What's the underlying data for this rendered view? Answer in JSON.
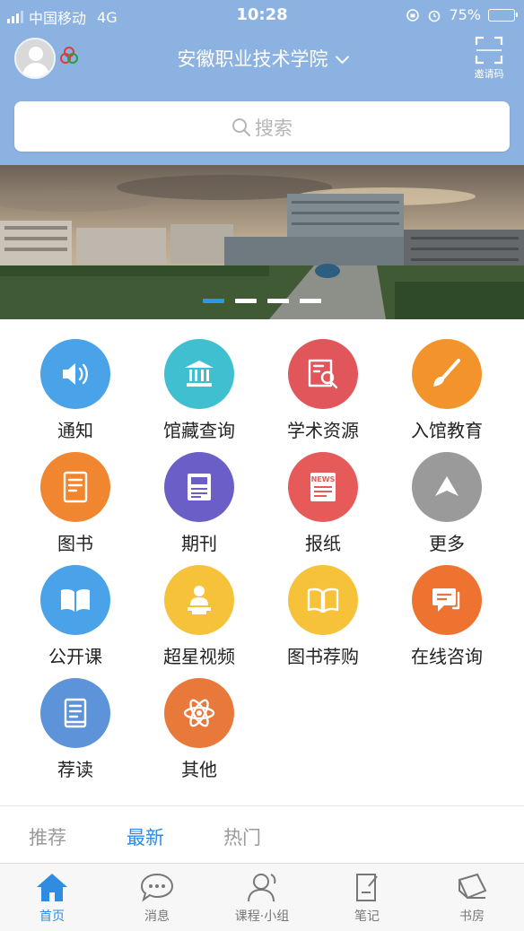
{
  "status_bar": {
    "carrier": "中国移动",
    "network": "4G",
    "time": "10:28",
    "battery_percent": "75%",
    "battery_level": 0.75
  },
  "header": {
    "school_name": "安徽职业技术学院",
    "invite_label": "邀请码",
    "search_placeholder": "搜索"
  },
  "banner": {
    "slide_count": 4,
    "active_slide": 0
  },
  "grid_items": [
    {
      "label": "通知",
      "icon": "speaker-icon",
      "color": "#4aa3e8"
    },
    {
      "label": "馆藏查询",
      "icon": "library-building-icon",
      "color": "#3fbfd0"
    },
    {
      "label": "学术资源",
      "icon": "search-document-icon",
      "color": "#e0565a"
    },
    {
      "label": "入馆教育",
      "icon": "brush-icon",
      "color": "#f3932b"
    },
    {
      "label": "图书",
      "icon": "book-icon",
      "color": "#f0862f"
    },
    {
      "label": "期刊",
      "icon": "journal-icon",
      "color": "#6b5fc7"
    },
    {
      "label": "报纸",
      "icon": "newspaper-icon",
      "color": "#e75a5a"
    },
    {
      "label": "更多",
      "icon": "chevron-up-icon",
      "color": "#9a9a9a"
    },
    {
      "label": "公开课",
      "icon": "open-book-icon",
      "color": "#4aa3e8"
    },
    {
      "label": "超星视频",
      "icon": "lecturer-icon",
      "color": "#f6c23a"
    },
    {
      "label": "图书荐购",
      "icon": "book-recommend-icon",
      "color": "#f6c23a"
    },
    {
      "label": "在线咨询",
      "icon": "chat-icon",
      "color": "#ee7230"
    },
    {
      "label": "荐读",
      "icon": "reading-icon",
      "color": "#5d93d8"
    },
    {
      "label": "其他",
      "icon": "atom-icon",
      "color": "#e8793a"
    }
  ],
  "feed_tabs": [
    {
      "label": "推荐",
      "active": false
    },
    {
      "label": "最新",
      "active": true
    },
    {
      "label": "热门",
      "active": false
    }
  ],
  "bottom_nav": [
    {
      "label": "首页",
      "icon": "home-icon",
      "active": true
    },
    {
      "label": "消息",
      "icon": "message-icon",
      "active": false
    },
    {
      "label": "课程·小组",
      "icon": "user-group-icon",
      "active": false
    },
    {
      "label": "笔记",
      "icon": "note-icon",
      "active": false
    },
    {
      "label": "书房",
      "icon": "bookshelf-icon",
      "active": false
    }
  ],
  "colors": {
    "header_bg": "#8cb2e2",
    "accent": "#2f8ce0"
  }
}
